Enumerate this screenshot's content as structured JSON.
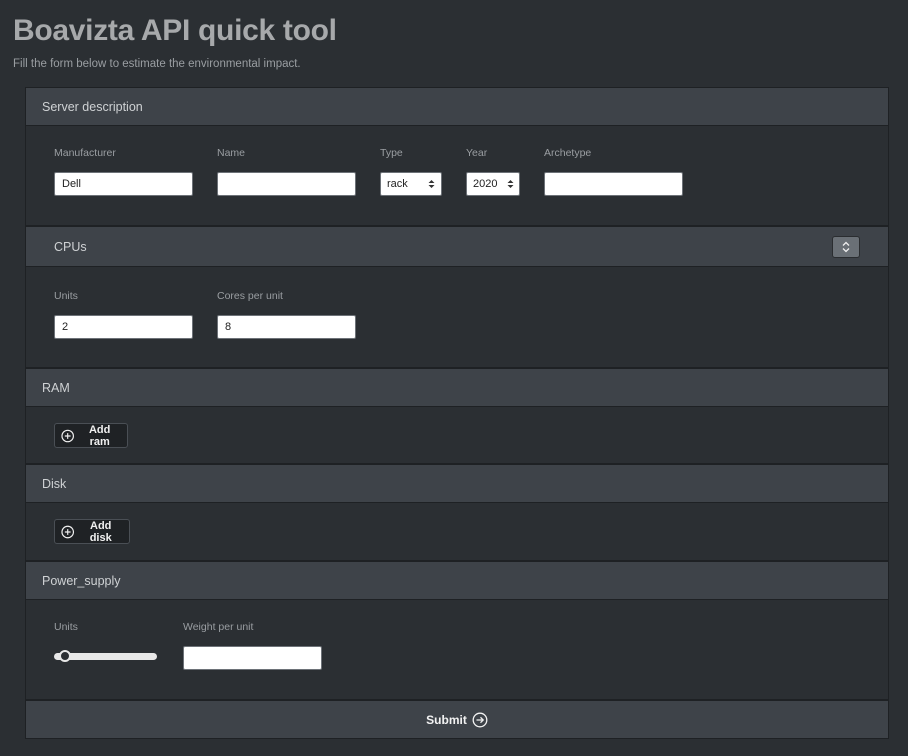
{
  "header": {
    "title": "Boavizta API quick tool",
    "subtitle": "Fill the form below to estimate the environmental impact."
  },
  "server": {
    "heading": "Server description",
    "manufacturer": {
      "label": "Manufacturer",
      "value": "Dell"
    },
    "name": {
      "label": "Name",
      "value": ""
    },
    "type": {
      "label": "Type",
      "value": "rack"
    },
    "year": {
      "label": "Year",
      "value": "2020"
    },
    "archetype": {
      "label": "Archetype",
      "value": ""
    }
  },
  "cpus": {
    "heading": "CPUs",
    "units": {
      "label": "Units",
      "value": "2"
    },
    "cores": {
      "label": "Cores per unit",
      "value": "8"
    }
  },
  "ram": {
    "heading": "RAM",
    "add_label": "Add ram"
  },
  "disk": {
    "heading": "Disk",
    "add_label": "Add disk"
  },
  "power_supply": {
    "heading": "Power_supply",
    "units": {
      "label": "Units",
      "slider_fraction": 0.05
    },
    "weight": {
      "label": "Weight per unit",
      "value": ""
    }
  },
  "submit": {
    "label": "Submit"
  }
}
